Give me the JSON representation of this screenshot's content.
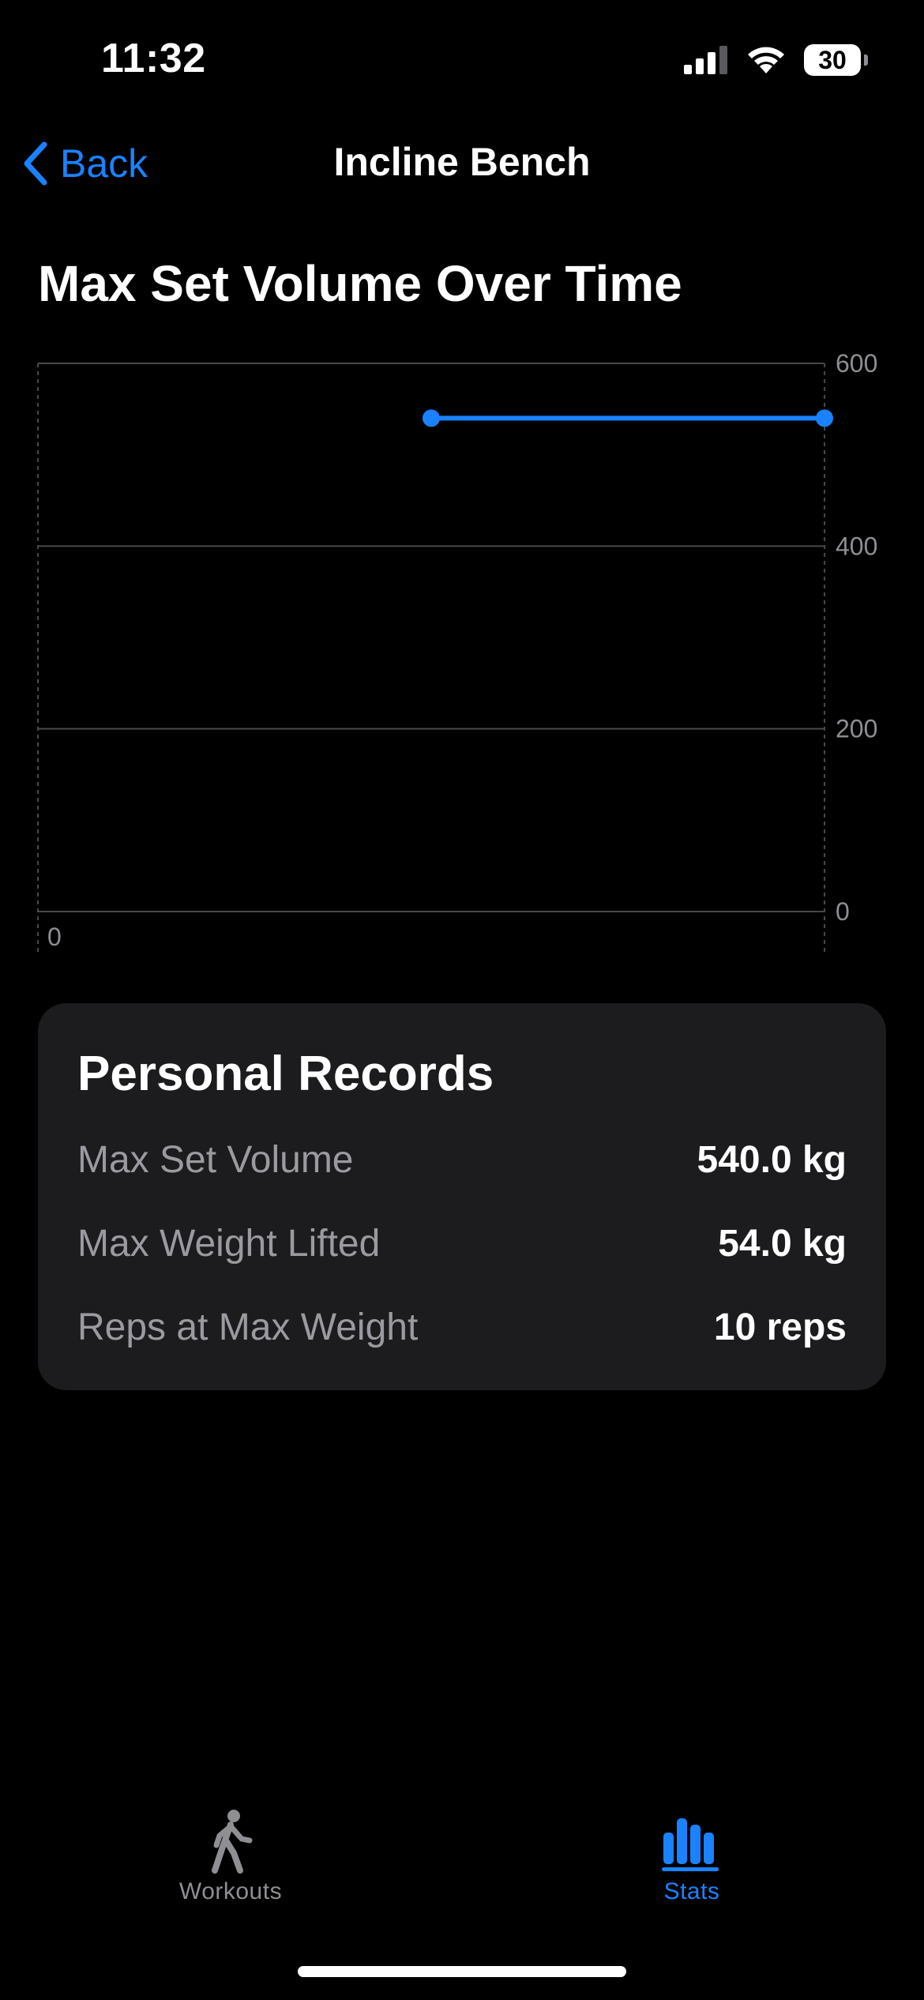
{
  "status_bar": {
    "time": "11:32",
    "battery": "30",
    "signal_icon": "cellular-signal-icon",
    "wifi_icon": "wifi-icon"
  },
  "nav": {
    "back_label": "Back",
    "title": "Incline Bench",
    "accent_color": "#1a82ff"
  },
  "chart_section": {
    "title": "Max Set Volume Over Time"
  },
  "chart_data": {
    "type": "line",
    "title": "Max Set Volume Over Time",
    "xlabel": "",
    "ylabel": "",
    "x_tick_labels": [
      "0"
    ],
    "y_ticks": [
      "600",
      "400",
      "200",
      "0"
    ],
    "ylim": [
      0,
      600
    ],
    "y_axis_side": "right",
    "grid": true,
    "series": [
      {
        "color": "#1a82ff",
        "points": [
          {
            "x": 0.5,
            "y": 540
          },
          {
            "x": 1.0,
            "y": 540
          }
        ]
      }
    ]
  },
  "personal_records": {
    "title": "Personal Records",
    "rows": [
      {
        "label": "Max Set Volume",
        "value": "540.0 kg"
      },
      {
        "label": "Max Weight Lifted",
        "value": "54.0 kg"
      },
      {
        "label": "Reps at Max Weight",
        "value": "10 reps"
      }
    ]
  },
  "tab_bar": {
    "tabs": [
      {
        "label": "Workouts",
        "icon": "walking-figure-icon",
        "active": false
      },
      {
        "label": "Stats",
        "icon": "bar-chart-icon",
        "active": true
      }
    ],
    "active_color": "#1a82ff",
    "inactive_color": "#8e8e93"
  }
}
